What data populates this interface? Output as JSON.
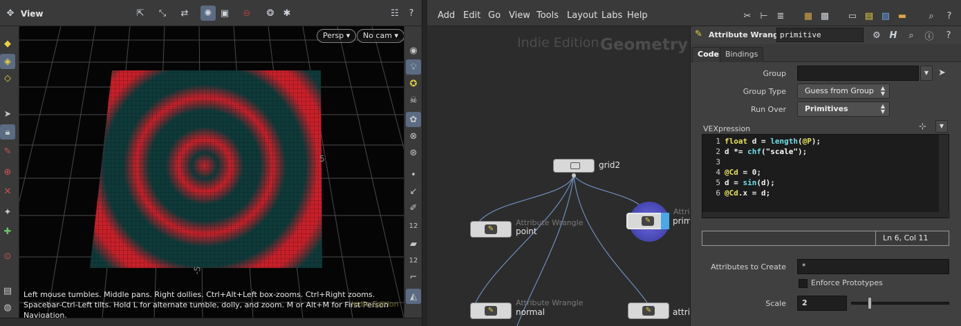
{
  "viewport": {
    "title": "View",
    "persp_label": "Persp",
    "cam_label": "No cam",
    "help_text": "Left mouse tumbles. Middle pans. Right dollies. Ctrl+Alt+Left box-zooms. Ctrl+Right zooms. Spacebar-Ctrl-Left tilts. Hold L for alternate tumble, dolly, and zoom.   M or Alt+M for First Person Navigation.",
    "edition_label": "Indie Edition",
    "grid_label_5": "5",
    "grid_label_neg5": "-5",
    "ring_color": "#c8202a",
    "base_color": "#0f3a3a"
  },
  "network": {
    "menus": [
      "Add",
      "Edit",
      "Go",
      "View",
      "Tools",
      "Layout",
      "Labs",
      "Help"
    ],
    "edition_label": "Indie Edition",
    "context_label": "Geometry",
    "nodes": {
      "grid": {
        "label": "grid2"
      },
      "point": {
        "type": "Attribute Wrangle",
        "label": "point"
      },
      "prim": {
        "type": "Attrib",
        "label": "prim"
      },
      "normal": {
        "type": "Attribute Wrangle",
        "label": "normal"
      },
      "attribwrangles": {
        "label": "attribwrangles"
      }
    },
    "wire_color": "#6f8fbf"
  },
  "params": {
    "node_type": "Attribute Wrangle",
    "node_name": "primitive",
    "tabs": [
      "Code",
      "Bindings"
    ],
    "group_label": "Group",
    "group_value": "",
    "group_type_label": "Group Type",
    "group_type_value": "Guess from Group",
    "run_over_label": "Run Over",
    "run_over_value": "Primitives",
    "vex_label": "VEXpression",
    "code_lines": [
      {
        "n": "1",
        "parts": [
          [
            "kw",
            "float"
          ],
          [
            "t",
            " d = "
          ],
          [
            "fn",
            "length"
          ],
          [
            "t",
            "("
          ],
          [
            "at",
            "@P"
          ],
          [
            "t",
            ");"
          ]
        ]
      },
      {
        "n": "2",
        "parts": [
          [
            "t",
            "d *= "
          ],
          [
            "fn",
            "chf"
          ],
          [
            "t",
            "("
          ],
          [
            "st",
            "\"scale\""
          ],
          [
            "t",
            ");"
          ]
        ]
      },
      {
        "n": "3",
        "parts": []
      },
      {
        "n": "4",
        "parts": [
          [
            "at",
            "@Cd"
          ],
          [
            "t",
            " = 0;"
          ]
        ]
      },
      {
        "n": "5",
        "parts": [
          [
            "t",
            "d = "
          ],
          [
            "fn",
            "sin"
          ],
          [
            "t",
            "(d);"
          ]
        ]
      },
      {
        "n": "6",
        "parts": [
          [
            "at",
            "@Cd"
          ],
          [
            "t",
            ".x = d;"
          ]
        ]
      }
    ],
    "status": "Ln 6, Col 11",
    "attrs_label": "Attributes to Create",
    "attrs_value": "*",
    "enforce_label": "Enforce Prototypes",
    "scale_label": "Scale",
    "scale_value": "2",
    "scale_fraction": 0.18
  }
}
